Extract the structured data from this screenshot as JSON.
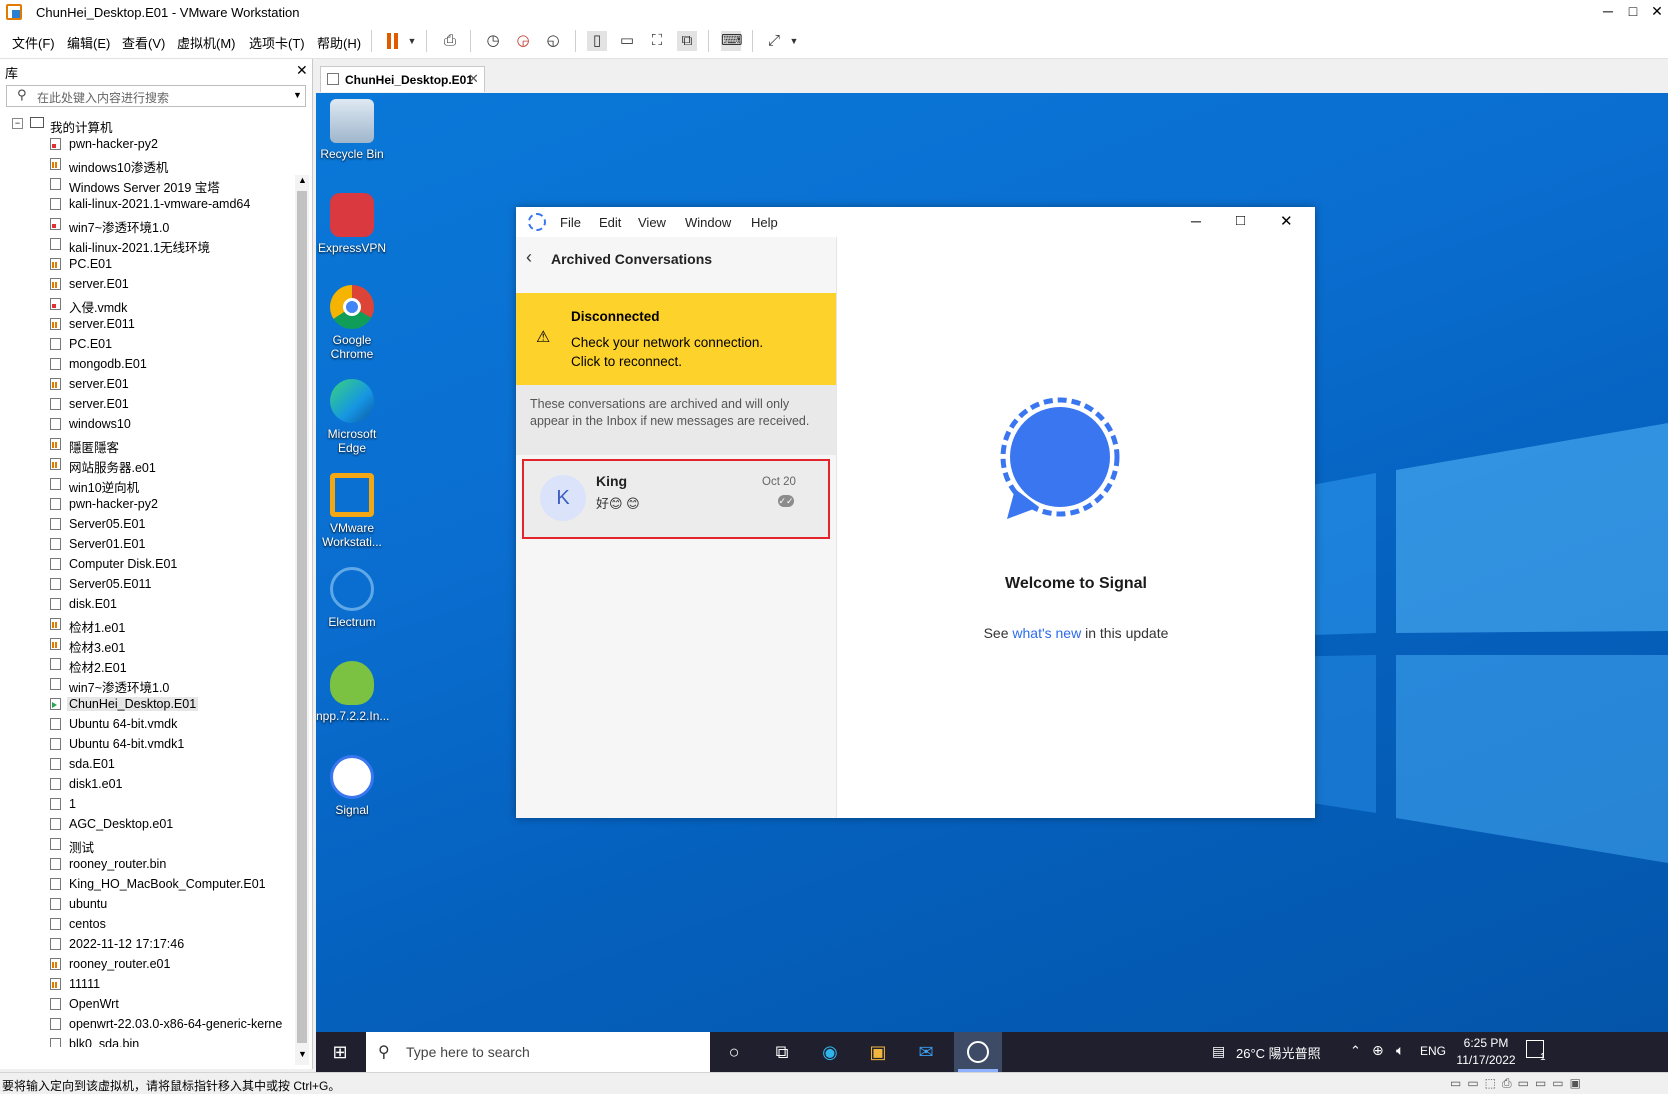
{
  "window": {
    "title": "ChunHei_Desktop.E01 - VMware Workstation"
  },
  "menubar": {
    "items": [
      "文件(F)",
      "编辑(E)",
      "查看(V)",
      "虚拟机(M)",
      "选项卡(T)",
      "帮助(H)"
    ]
  },
  "library": {
    "title": "库",
    "search_placeholder": "在此处键入内容进行搜索",
    "root": "我的计算机",
    "vms": [
      {
        "name": "pwn-hacker-py2",
        "icon": "vm-red"
      },
      {
        "name": "windows10渗透机",
        "icon": "vm-orange"
      },
      {
        "name": "Windows Server 2019 宝塔",
        "icon": "vm"
      },
      {
        "name": "kali-linux-2021.1-vmware-amd64",
        "icon": "vm"
      },
      {
        "name": "win7~渗透环境1.0",
        "icon": "vm-red"
      },
      {
        "name": "kali-linux-2021.1无线环境",
        "icon": "vm"
      },
      {
        "name": "PC.E01",
        "icon": "vm-orange"
      },
      {
        "name": "server.E01",
        "icon": "vm-orange"
      },
      {
        "name": "入侵.vmdk",
        "icon": "vm-red"
      },
      {
        "name": "server.E011",
        "icon": "vm-orange"
      },
      {
        "name": "PC.E01",
        "icon": "vm"
      },
      {
        "name": "mongodb.E01",
        "icon": "vm"
      },
      {
        "name": "server.E01",
        "icon": "vm-orange"
      },
      {
        "name": "server.E01",
        "icon": "vm"
      },
      {
        "name": "windows10",
        "icon": "vm"
      },
      {
        "name": "隱匿隱客",
        "icon": "vm-orange"
      },
      {
        "name": "网站服务器.e01",
        "icon": "vm-orange"
      },
      {
        "name": "win10逆向机",
        "icon": "vm"
      },
      {
        "name": "pwn-hacker-py2",
        "icon": "vm"
      },
      {
        "name": "Server05.E01",
        "icon": "vm"
      },
      {
        "name": "Server01.E01",
        "icon": "vm"
      },
      {
        "name": "Computer Disk.E01",
        "icon": "vm"
      },
      {
        "name": "Server05.E011",
        "icon": "vm"
      },
      {
        "name": "disk.E01",
        "icon": "vm"
      },
      {
        "name": "检材1.e01",
        "icon": "vm-orange"
      },
      {
        "name": "检材3.e01",
        "icon": "vm-orange"
      },
      {
        "name": "检材2.E01",
        "icon": "vm"
      },
      {
        "name": "win7~渗透环境1.0",
        "icon": "vm"
      },
      {
        "name": "ChunHei_Desktop.E01",
        "icon": "vm-green",
        "selected": true
      },
      {
        "name": "Ubuntu 64-bit.vmdk",
        "icon": "vm"
      },
      {
        "name": "Ubuntu 64-bit.vmdk1",
        "icon": "vm"
      },
      {
        "name": "sda.E01",
        "icon": "vm"
      },
      {
        "name": "disk1.e01",
        "icon": "vm"
      },
      {
        "name": "1",
        "icon": "vm"
      },
      {
        "name": "AGC_Desktop.e01",
        "icon": "vm"
      },
      {
        "name": "测试",
        "icon": "vm"
      },
      {
        "name": "rooney_router.bin",
        "icon": "vm"
      },
      {
        "name": "King_HO_MacBook_Computer.E01",
        "icon": "vm"
      },
      {
        "name": "ubuntu",
        "icon": "vm"
      },
      {
        "name": "centos",
        "icon": "vm"
      },
      {
        "name": "2022-11-12 17:17:46",
        "icon": "vm"
      },
      {
        "name": "rooney_router.e01",
        "icon": "vm-orange"
      },
      {
        "name": "11111",
        "icon": "vm-orange"
      },
      {
        "name": "OpenWrt",
        "icon": "vm"
      },
      {
        "name": "openwrt-22.03.0-x86-64-generic-kerne",
        "icon": "vm"
      },
      {
        "name": "blk0_sda.bin",
        "icon": "vm"
      }
    ]
  },
  "vm_tab": {
    "label": "ChunHei_Desktop.E01"
  },
  "desktop_icons": [
    {
      "label": "Recycle Bin",
      "icon": "recycle-bin-icon"
    },
    {
      "label": "ExpressVPN",
      "icon": "expressvpn-icon"
    },
    {
      "label": "Google Chrome",
      "icon": "chrome-icon"
    },
    {
      "label": "Microsoft Edge",
      "icon": "edge-icon"
    },
    {
      "label": "VMware Workstati...",
      "icon": "vmware-icon"
    },
    {
      "label": "Electrum",
      "icon": "electrum-icon"
    },
    {
      "label": "npp.7.2.2.In...",
      "icon": "notepadpp-icon"
    },
    {
      "label": "Signal",
      "icon": "signal-icon"
    }
  ],
  "signal": {
    "menu": [
      "File",
      "Edit",
      "View",
      "Window",
      "Help"
    ],
    "header": "Archived Conversations",
    "banner": {
      "title": "Disconnected",
      "line1": "Check your network connection.",
      "line2": "Click to reconnect."
    },
    "notice": "These conversations are archived and will only appear in the Inbox if new messages are received.",
    "conversation": {
      "avatar": "K",
      "name": "King",
      "date": "Oct 20",
      "preview": "好😊 😊"
    },
    "welcome": {
      "title": "Welcome to Signal",
      "see": "See",
      "link": "what's new",
      "suffix": "in this update"
    }
  },
  "taskbar": {
    "search_placeholder": "Type here to search",
    "weather": "26°C 陽光普照",
    "lang": "ENG",
    "time": "6:25 PM",
    "date": "11/17/2022",
    "notifications": "1"
  },
  "statusbar": {
    "text": "要将输入定向到该虚拟机，请将鼠标指针移入其中或按 Ctrl+G。"
  },
  "colors": {
    "signal_blue": "#3a76f0",
    "banner_yellow": "#fdd22b",
    "highlight_red": "#e3242b",
    "desktop_blue": "#0a6ed0"
  }
}
